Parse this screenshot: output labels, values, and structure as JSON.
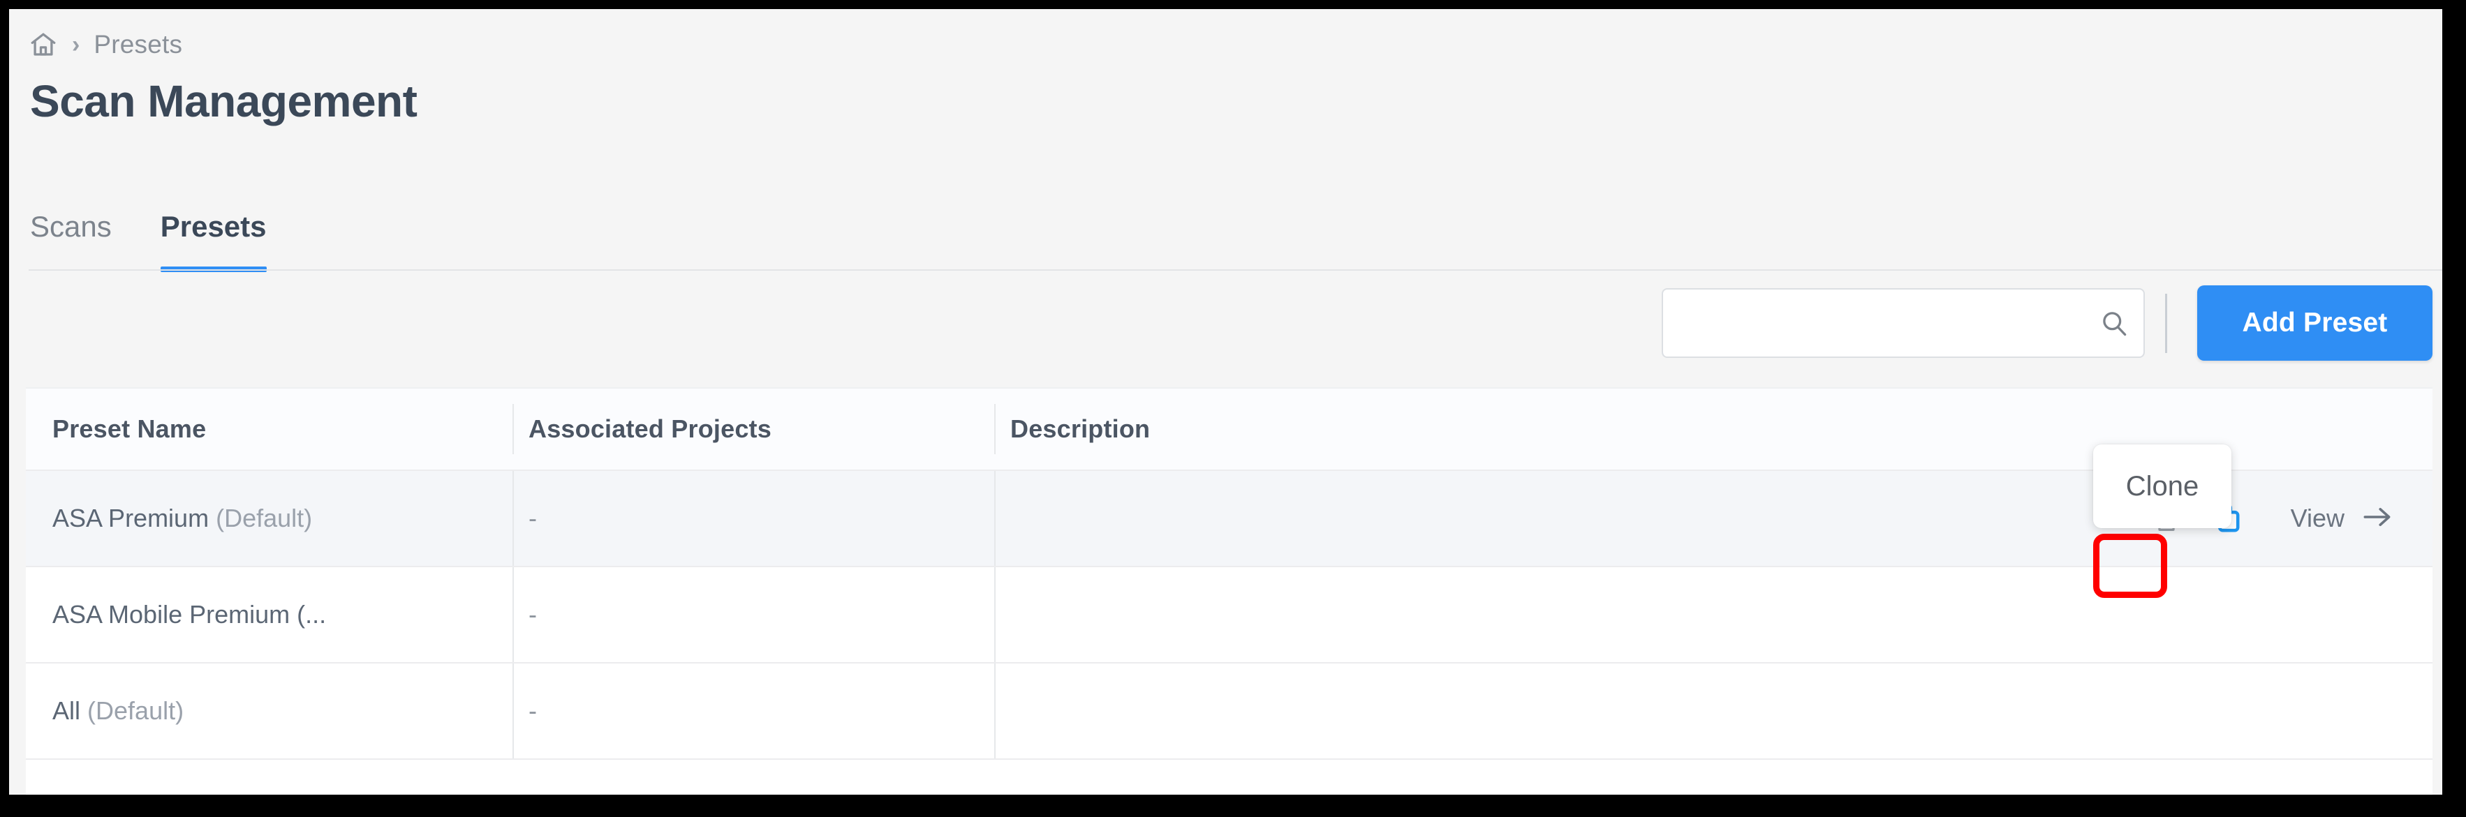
{
  "breadcrumb": {
    "home_icon": "home-icon",
    "separator": "›",
    "current": "Presets"
  },
  "page_title": "Scan Management",
  "tabs": [
    {
      "label": "Scans",
      "active": false
    },
    {
      "label": "Presets",
      "active": true
    }
  ],
  "toolbar": {
    "search": {
      "value": "",
      "placeholder": "",
      "icon": "search-icon"
    },
    "add_button_label": "Add Preset"
  },
  "table": {
    "columns": [
      "Preset Name",
      "Associated Projects",
      "Description"
    ],
    "rows": [
      {
        "name": "ASA Premium",
        "name_suffix": "(Default)",
        "associated_projects": "-",
        "description": "",
        "highlighted": true,
        "actions": {
          "delete_icon": "trash-icon",
          "clone_icon": "clone-icon",
          "view_label": "View",
          "view_arrow": "arrow-right-icon"
        }
      },
      {
        "name": "ASA Mobile Premium (...",
        "name_suffix": "",
        "associated_projects": "-",
        "description": "",
        "highlighted": false
      },
      {
        "name": "All",
        "name_suffix": "(Default)",
        "associated_projects": "-",
        "description": "",
        "highlighted": false
      }
    ]
  },
  "tooltip": {
    "text": "Clone"
  },
  "annotation": {
    "shape": "rounded-rect",
    "color": "#ff0000",
    "target": "clone-icon"
  },
  "colors": {
    "accent": "#2f8ef4",
    "page_background": "#f5f5f5",
    "card_background": "#ffffff",
    "row_highlight": "#f4f6f9",
    "title_text": "#3b4858",
    "muted_text": "#8b9199",
    "annotation_red": "#ff0000"
  }
}
